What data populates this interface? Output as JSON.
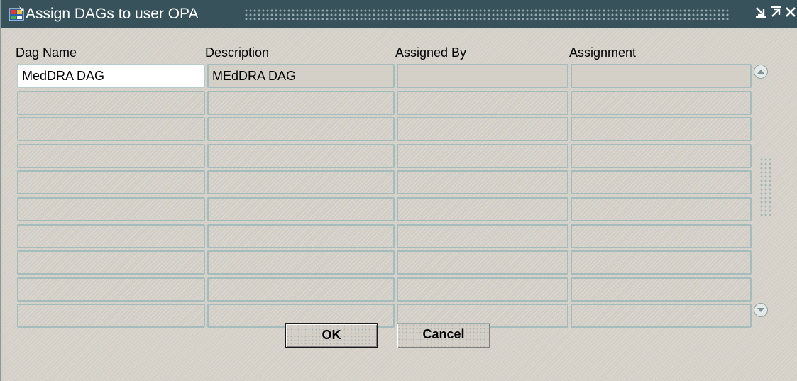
{
  "window": {
    "title": "Assign DAGs to user OPA",
    "icon": "oracle-forms-app-icon",
    "controls": [
      "minimize-icon",
      "maximize-icon",
      "close-icon"
    ]
  },
  "table": {
    "columns": [
      "Dag Name",
      "Description",
      "Assigned By",
      "Assignment"
    ],
    "rows": [
      [
        "MedDRA DAG",
        "MEdDRA DAG",
        "",
        ""
      ],
      [
        "",
        "",
        "",
        ""
      ],
      [
        "",
        "",
        "",
        ""
      ],
      [
        "",
        "",
        "",
        ""
      ],
      [
        "",
        "",
        "",
        ""
      ],
      [
        "",
        "",
        "",
        ""
      ],
      [
        "",
        "",
        "",
        ""
      ],
      [
        "",
        "",
        "",
        ""
      ],
      [
        "",
        "",
        "",
        ""
      ],
      [
        "",
        "",
        "",
        ""
      ]
    ]
  },
  "scrollbar": {
    "up_icon": "scroll-up-icon",
    "down_icon": "scroll-down-icon"
  },
  "buttons": {
    "ok": "OK",
    "cancel": "Cancel"
  }
}
